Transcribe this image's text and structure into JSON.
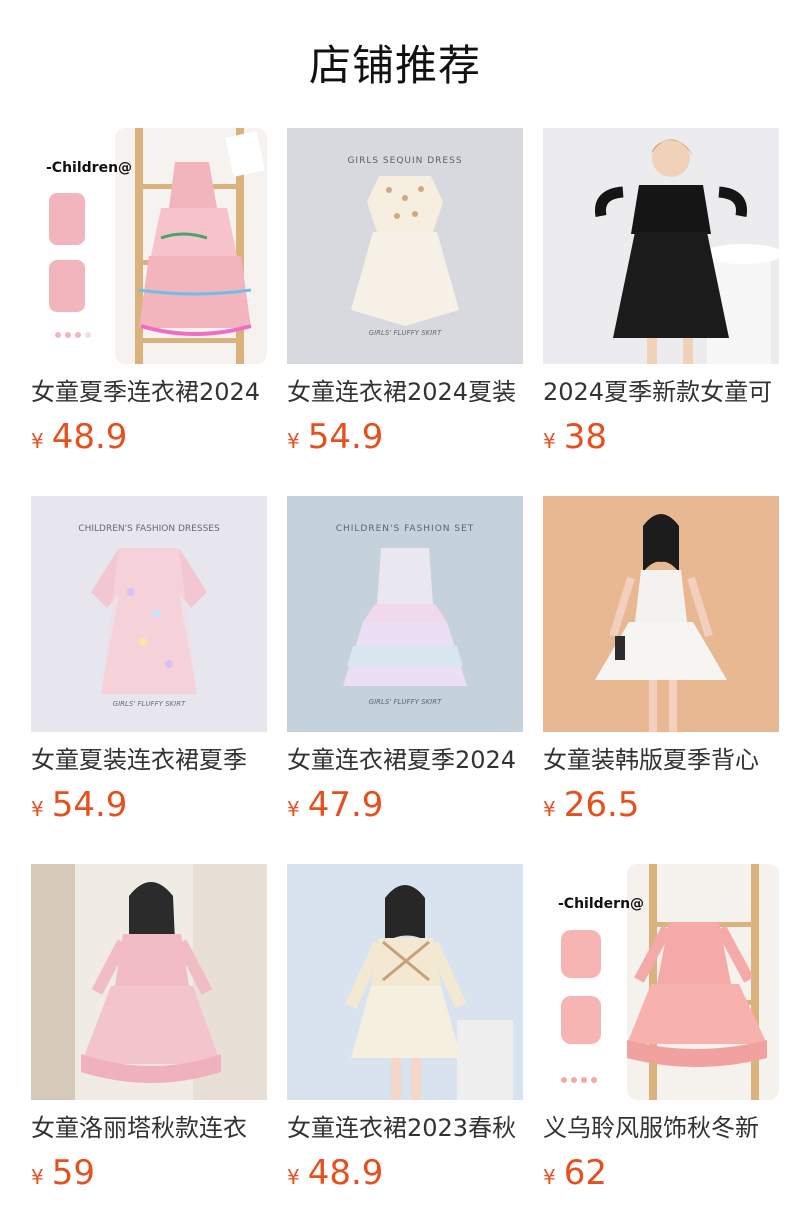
{
  "header": {
    "title": "店铺推荐"
  },
  "currency_symbol": "¥",
  "products": [
    {
      "name": "女童夏季连衣裙2024",
      "price": "48.9",
      "image_text": "-Children@",
      "image_colors": {
        "bg": "#f5f2ef",
        "accent": "#f2b5be",
        "wood": "#d9b27e"
      }
    },
    {
      "name": "女童连衣裙2024夏装",
      "price": "54.9",
      "image_text": "GIRLS SEQUIN DRESS",
      "image_subtext": "GIRLS' FLUFFY SKIRT",
      "image_colors": {
        "bg": "#d8d9df",
        "accent": "#f6efe0",
        "wood": "#d8ba9f"
      }
    },
    {
      "name": "2024夏季新款女童可",
      "price": "38",
      "image_colors": {
        "bg": "#ececef",
        "accent": "#151515",
        "wood": "#f1d2b8"
      }
    },
    {
      "name": "女童夏装连衣裙夏季",
      "price": "54.9",
      "image_text": "CHILDREN'S FASHION DRESSES",
      "image_subtext": "GIRLS' FLUFFY SKIRT",
      "image_colors": {
        "bg": "#e7e6ee",
        "accent": "#f3c7d2",
        "wood": "#d9c2f3"
      }
    },
    {
      "name": "女童连衣裙夏季2024",
      "price": "47.9",
      "image_text": "CHILDREN'S FASHION SET",
      "image_subtext": "GIRLS' FLUFFY SKIRT",
      "image_colors": {
        "bg": "#c5d1db",
        "accent": "#f0d9ec",
        "wood": "#d7e6ef"
      }
    },
    {
      "name": "女童装韩版夏季背心",
      "price": "26.5",
      "image_colors": {
        "bg": "#e8b892",
        "accent": "#f4f2ee",
        "wood": "#2c2c2c"
      }
    },
    {
      "name": "女童洛丽塔秋款连衣",
      "price": "59",
      "image_colors": {
        "bg": "#f1ebe5",
        "accent": "#f1bcc4",
        "wood": "#d7c9b9"
      }
    },
    {
      "name": "女童连衣裙2023春秋",
      "price": "48.9",
      "image_colors": {
        "bg": "#d8e3ef",
        "accent": "#f3e9d2",
        "wood": "#eeeeee"
      }
    },
    {
      "name": "义乌聆风服饰秋冬新",
      "price": "62",
      "image_text": "-Childern@",
      "image_colors": {
        "bg": "#f5f1ed",
        "accent": "#f4aaa8",
        "wood": "#d9b27e"
      }
    }
  ]
}
